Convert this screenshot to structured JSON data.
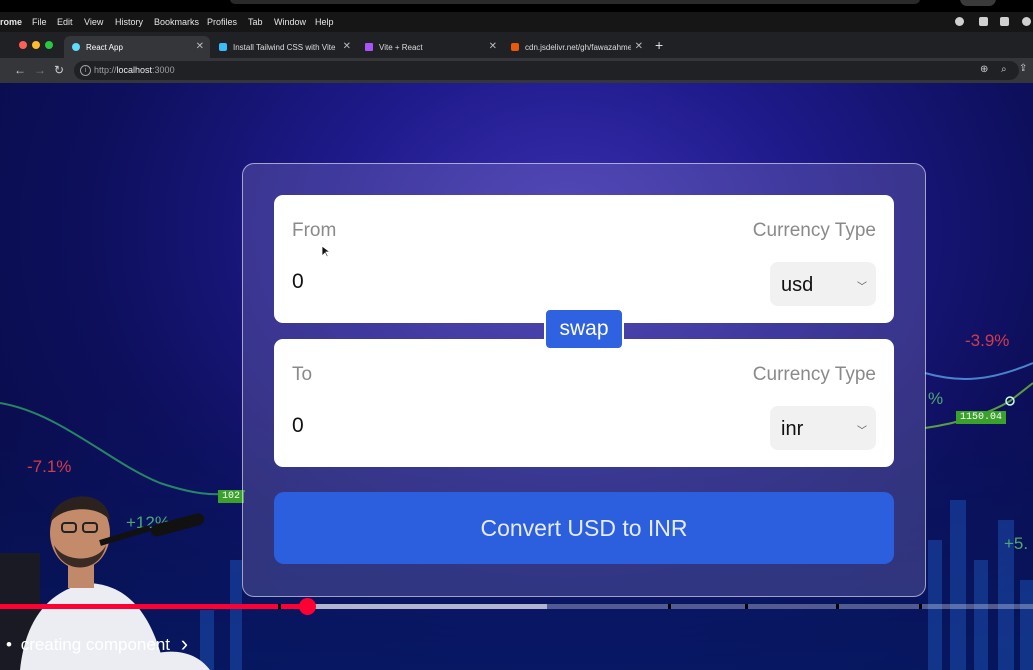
{
  "os_menu": {
    "items": [
      "rome",
      "File",
      "Edit",
      "View",
      "History",
      "Bookmarks",
      "Profiles",
      "Tab",
      "Window",
      "Help"
    ]
  },
  "browser": {
    "tabs": [
      {
        "label": "React App",
        "active": true,
        "icon": "react-icon"
      },
      {
        "label": "Install Tailwind CSS with Vite -",
        "active": false,
        "icon": "tailwind-icon"
      },
      {
        "label": "Vite + React",
        "active": false,
        "icon": "vite-icon"
      },
      {
        "label": "cdn.jsdelivr.net/gh/fawazahmed",
        "active": false,
        "icon": "shield-icon"
      }
    ],
    "url_prefix": "http://",
    "url_host": "localhost",
    "url_suffix": ":3000"
  },
  "background": {
    "ticks": [
      {
        "text": "-7.1%",
        "color": "#d23c4c"
      },
      {
        "text": "+12%",
        "color": "#4fa874"
      },
      {
        "text": "-3.9%",
        "color": "#d23c4c"
      },
      {
        "text": "%",
        "color": "#4fa874"
      },
      {
        "text": "+5.",
        "color": "#4fa874"
      }
    ],
    "price_tags": [
      "1150.04",
      "102"
    ]
  },
  "converter": {
    "from": {
      "label": "From",
      "currency_type_label": "Currency Type",
      "amount": "0",
      "currency": "usd"
    },
    "to": {
      "label": "To",
      "currency_type_label": "Currency Type",
      "amount": "0",
      "currency": "inr"
    },
    "swap_label": "swap",
    "convert_label": "Convert USD to INR",
    "colors": {
      "button": "#2b5fde",
      "swap": "#2f62e1"
    }
  },
  "video": {
    "chapter_prefix": "•",
    "chapter": "creating component",
    "chapter_arrow": "›",
    "played_fraction": 0.298,
    "buffered_fraction": 0.53,
    "progress_color": "#ff0033"
  }
}
